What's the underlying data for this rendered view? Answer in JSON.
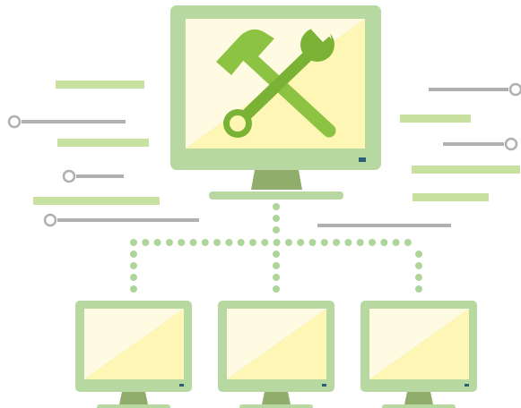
{
  "illustration": {
    "type": "network maintenance illustration",
    "main_monitor": {
      "icons": [
        "hammer-icon",
        "wrench-icon"
      ],
      "status_led": "on"
    },
    "client_monitors": [
      {
        "name": "left"
      },
      {
        "name": "center"
      },
      {
        "name": "right"
      }
    ]
  },
  "colors": {
    "frame": "#b7d8a1",
    "stand": "#91ad6b",
    "screen_light": "#fffbe3",
    "screen_yellow": "#fef6b5",
    "tool": "#8cc342",
    "tool_dark": "#7ab235",
    "accent_line": "#c8e0a0",
    "gray_line": "#b0b0b0",
    "dots": "#aed59a",
    "led": "#2d5f78"
  }
}
